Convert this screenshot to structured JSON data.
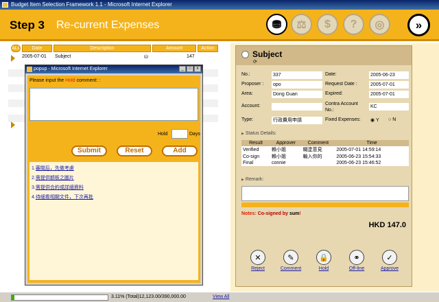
{
  "window": {
    "title": "Budget Item Selection Framework 1.1 - Microsoft Internet Explorer"
  },
  "header": {
    "step": "Step 3",
    "subtitle": "Re-current Expenses",
    "icons": [
      "bank-icon",
      "scale-icon",
      "coins-icon",
      "help-icon",
      "search-globe-icon"
    ],
    "next_icon": "double-chevron-right-icon"
  },
  "list": {
    "columns": {
      "all": "ALL",
      "date": "Date",
      "description": "Description",
      "amount": "Amount",
      "action": "Action"
    },
    "rows": [
      {
        "date": "2005-07-01",
        "description": "Subject",
        "amount": "147"
      }
    ]
  },
  "popup": {
    "title": "popup - Microsoft Internet Explorer",
    "prompt_pre": "Please input the ",
    "prompt_hl": "Hold",
    "prompt_post": " comment: :",
    "hold_label": "Hold",
    "days_label": "Days",
    "buttons": {
      "submit": "Submit",
      "reset": "Reset",
      "add": "Add"
    },
    "links": [
      {
        "num": "1.",
        "text": "審閱后，先做考慮"
      },
      {
        "num": "2.",
        "text": "需提供額板之圖片"
      },
      {
        "num": "3.",
        "text": "需提供合約或詳細資料"
      },
      {
        "num": "4.",
        "text": "待細看相關文件，下次再批"
      }
    ]
  },
  "detail": {
    "subject": "Subject",
    "fields": {
      "no_label": "No.:",
      "no": "337",
      "date_label": "Date:",
      "date": "2005-06-23",
      "proposer_label": "Proposer :",
      "proposer": "opo",
      "request_label": "Request Date :",
      "request": "2005-07-01",
      "area_label": "Area:",
      "area": "Dong Guan",
      "expired_label": "Expired:",
      "expired": "2005-07-01",
      "account_label": "Account:",
      "account": "",
      "contra_label": "Contra Account No.:",
      "contra": "KC",
      "type_label": "Type:",
      "type": "行政費用申請",
      "fixed_label": "Fixed Expenses:",
      "fixed_y": "Y",
      "fixed_n": "N"
    },
    "status_title": "Status Details:",
    "status_cols": {
      "result": "Result",
      "approver": "Approver",
      "comment": "Comment",
      "time": "Time"
    },
    "status_rows": [
      {
        "result": "Verified",
        "approver": "賴小姐",
        "comment": "糊塗意見",
        "time": "2005-07-01 14:59:14"
      },
      {
        "result": "Co-sign",
        "approver": "賴小姐",
        "comment": "輸入你的",
        "time": "2005-06-23 15:54:33"
      },
      {
        "result": "Final",
        "approver": "connie",
        "comment": "",
        "time": "2005-06-23 15:46:52"
      }
    ],
    "remark_title": "Remark:",
    "notes_label": "Notes:",
    "notes_text": " Co-signed by ",
    "notes_sum": "sum",
    "notes_end": "!",
    "total": "HKD 147.0",
    "actions": [
      {
        "label": "Reject",
        "icon": "reject-x-icon"
      },
      {
        "label": "Comment",
        "icon": "comment-icon"
      },
      {
        "label": "Hold",
        "icon": "lock-icon"
      },
      {
        "label": "Off-line",
        "icon": "offline-icon"
      },
      {
        "label": "Approve",
        "icon": "check-icon"
      }
    ]
  },
  "statusbar": {
    "progress": 0.0311,
    "progress_text": "3.11%",
    "total_text": "(Total)12,123.00/390,000.00",
    "view_all": "View All"
  }
}
